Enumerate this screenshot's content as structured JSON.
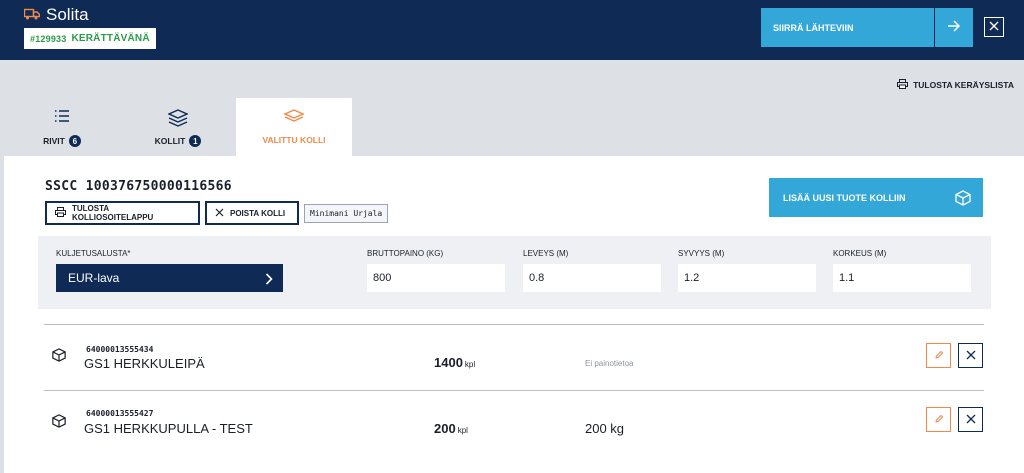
{
  "header": {
    "app_title": "Solita",
    "order_number": "#129933",
    "order_status": "KERÄTTÄVÄNÄ",
    "move_button_label": "SIIRRÄ LÄHTEVIIN"
  },
  "toolbar": {
    "print_list_label": "TULOSTA KERÄYSLISTA"
  },
  "tabs": [
    {
      "label": "RIVIT",
      "count": "6"
    },
    {
      "label": "KOLLIT",
      "count": "1"
    },
    {
      "label": "VALITTU KOLLI"
    }
  ],
  "package": {
    "sscc": "SSCC 100376750000116566",
    "print_label_button": "TULOSTA KOLLIOSOITELAPPU",
    "remove_button": "POISTA KOLLI",
    "tag": "Minimani Urjala",
    "add_product_button": "LISÄÄ UUSI TUOTE KOLLIIN"
  },
  "form": {
    "transport_label": "KULJETUSALUSTA*",
    "transport_value": "EUR-lava",
    "gross_weight_label": "BRUTTOPAINO (KG)",
    "gross_weight_value": "800",
    "width_label": "LEVEYS (M)",
    "width_value": "0.8",
    "depth_label": "SYVYYS (M)",
    "depth_value": "1.2",
    "height_label": "KORKEUS (M)",
    "height_value": "1.1"
  },
  "items": [
    {
      "code": "64000013555434",
      "name": "GS1 HERKKULEIPÄ",
      "quantity": "1400",
      "unit": "kpl",
      "weight": "Ei painotietoa"
    },
    {
      "code": "64000013555427",
      "name": "GS1 HERKKUPULLA - TEST",
      "quantity": "200",
      "unit": "kpl",
      "weight": "200 kg"
    }
  ],
  "colors": {
    "navy": "#0f2a55",
    "accent_blue": "#33a7d8",
    "accent_orange": "#f08a4b",
    "status_green": "#2b9a4a"
  }
}
